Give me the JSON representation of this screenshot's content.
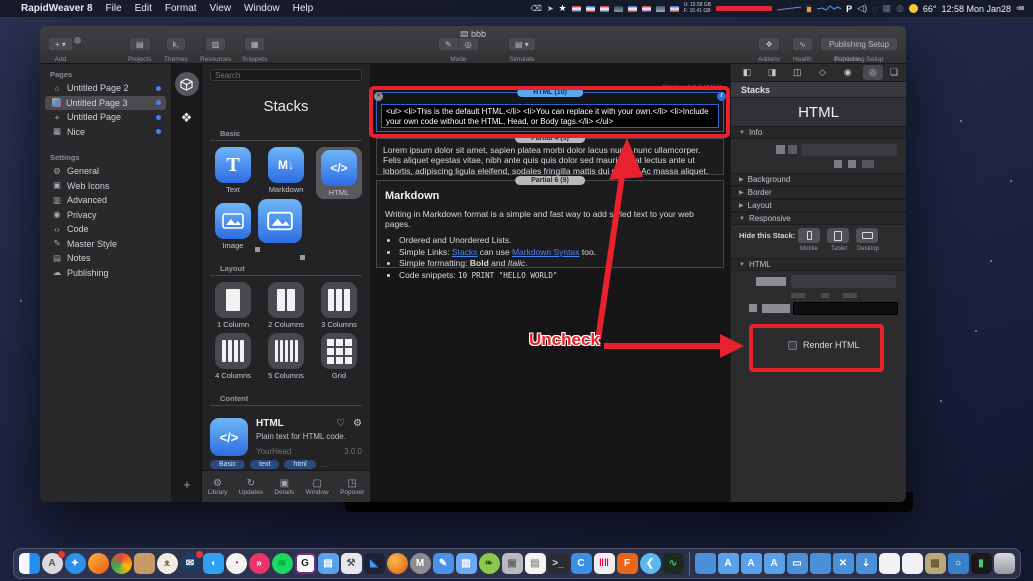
{
  "menu_bar": {
    "apple": "",
    "items": [
      "RapidWeaver 8",
      "File",
      "Edit",
      "Format",
      "View",
      "Window",
      "Help"
    ],
    "status": {
      "mem_used": "U: 15.58 GB",
      "mem_free": "F: 16.41 GB",
      "p_icon": "P",
      "temp": "66°",
      "clock": "12:58 Mon Jan28"
    }
  },
  "window": {
    "title": "bbb",
    "toolbar": {
      "add": "Add",
      "projects": "Projects",
      "themes": "Themes",
      "resources": "Resources",
      "snippets": "Snippets",
      "mode": "Mode",
      "simulate": "Simulate",
      "addons": "Addons",
      "health": "Health",
      "inspector": "Inspector",
      "publishing_button": "Publishing Setup",
      "publishing_caption": "Publishing Setup"
    }
  },
  "sidebar": {
    "pages_label": "Pages",
    "pages": [
      {
        "label": "Untitled Page 2"
      },
      {
        "label": "Untitled Page 3"
      },
      {
        "label": "Untitled Page"
      },
      {
        "label": "Nice"
      }
    ],
    "settings_label": "Settings",
    "settings": [
      {
        "label": "General"
      },
      {
        "label": "Web Icons"
      },
      {
        "label": "Advanced"
      },
      {
        "label": "Privacy"
      },
      {
        "label": "Code"
      },
      {
        "label": "Master Style"
      },
      {
        "label": "Notes"
      },
      {
        "label": "Publishing"
      }
    ]
  },
  "library": {
    "search_placeholder": "Search",
    "title": "Stacks",
    "basic_label": "Basic",
    "basic": [
      {
        "label": "Text",
        "glyph": "T"
      },
      {
        "label": "Markdown",
        "glyph": "M↓"
      },
      {
        "label": "HTML",
        "glyph": "</>"
      },
      {
        "label": "Image",
        "glyph": ""
      }
    ],
    "layout_label": "Layout",
    "layout": [
      {
        "label": "1 Column"
      },
      {
        "label": "2 Columns"
      },
      {
        "label": "3 Columns"
      },
      {
        "label": "4 Columns"
      },
      {
        "label": "5 Columns"
      },
      {
        "label": "Grid"
      }
    ],
    "content_label": "Content",
    "detail": {
      "name": "HTML",
      "glyph": "</>",
      "desc": "Plain text for HTML code.",
      "vendor": "YourHead",
      "version": "3.0.0",
      "tags": [
        "Basic",
        "text",
        "html"
      ],
      "more_tags": "..."
    },
    "footer": [
      {
        "label": "Library"
      },
      {
        "label": "Updates"
      },
      {
        "label": "Details"
      },
      {
        "label": "Window"
      },
      {
        "label": "Popover"
      }
    ]
  },
  "canvas": {
    "version": "Stacks v4.0.0 (4413)",
    "html_pill": "HTML (10)",
    "html_code": "<ul> <li>This is the default HTML.</li> <li>You can replace it with your own.</li> <li>Include your own code without the HTML, Head, or Body tags.</li> </ul>",
    "partial1_pill": "Partial 4 (9)",
    "lorem": "Lorem ipsum dolor sit amet, sapien platea morbi dolor lacus nunc, nunc ullamcorper. Felis aliquet egestas vitae, nibh ante quis quis dolor sed mauris. Erat lectus ante ut lobortis, adipiscing ligula eleifend, sodales fringilla mattis dui nullam. Ac massa aliquet.",
    "partial2_pill": "Partial 6 (9)",
    "markdown": {
      "title": "Markdown",
      "intro": "Writing in Markdown format is a simple and fast way to add styled text to your web pages.",
      "b1": "Ordered and Unordered Lists.",
      "b2_pre": "Simple Links: ",
      "b2_link1": "Stacks",
      "b2_mid": " can use ",
      "b2_link2": "Markdown Syntax",
      "b2_post": " too.",
      "b3_pre": "Simple formatting: ",
      "b3_bold": "Bold",
      "b3_mid": " and ",
      "b3_italic": "Italic",
      "b3_post": ".",
      "b4_pre": "Code snippets: ",
      "b4_code": "10 PRINT \"HELLO WORLD\""
    }
  },
  "inspector": {
    "header": "Stacks",
    "title": "HTML",
    "sections": {
      "info": "Info",
      "background": "Background",
      "border": "Border",
      "layout": "Layout",
      "responsive": "Responsive",
      "html": "HTML"
    },
    "hide_label": "Hide this Stack:",
    "devices": [
      {
        "label": "Mobile"
      },
      {
        "label": "Tablet"
      },
      {
        "label": "Desktop"
      }
    ],
    "render_label": "Render HTML"
  },
  "annotations": {
    "uncheck": "Uncheck",
    "color": "#e8222c"
  },
  "dock": {
    "items": [
      {
        "n": "finder",
        "c": "linear-gradient(90deg,#f5f7fa 50%,#1f8ef0 50%)",
        "s": "sq",
        "g": ""
      },
      {
        "n": "app-store",
        "c": "#d9d9de",
        "s": "ci",
        "g": "A",
        "fg": "#555",
        "badge": true
      },
      {
        "n": "safari",
        "c": "#2f90ea",
        "s": "ci",
        "g": "✦"
      },
      {
        "n": "firefox",
        "c": "linear-gradient(135deg,#ffb340,#e85d10)",
        "s": "ci",
        "g": ""
      },
      {
        "n": "chrome",
        "c": "conic-gradient(#ea4335,#fbbc05,#34a853,#ea4335)",
        "s": "ci",
        "g": "◦",
        "fg": "#4a90e2"
      },
      {
        "n": "rss-reader",
        "c": "#c79a66",
        "s": "sq",
        "g": ""
      },
      {
        "n": "dog-app",
        "c": "#f2ebe2",
        "s": "ci",
        "g": "ᴥ",
        "fg": "#8a6a4a"
      },
      {
        "n": "mail-clock",
        "c": "#1c3c62",
        "s": "ci",
        "g": "✉",
        "badge": true
      },
      {
        "n": "messages",
        "c": "#2fa0f2",
        "s": "sq",
        "g": "◖"
      },
      {
        "n": "color-wheel",
        "c": "#f2f2f4",
        "s": "ci",
        "g": "◔",
        "fg": "#e06"
      },
      {
        "n": "shift",
        "c": "#e8356c",
        "s": "ci",
        "g": "»"
      },
      {
        "n": "spotify",
        "c": "#1ed760",
        "s": "ci",
        "g": "≋",
        "fg": "#0a3"
      },
      {
        "n": "genius",
        "c": "#ffffff",
        "s": "sq",
        "g": "G",
        "fg": "#222",
        "bd": "#7a2a8a"
      },
      {
        "n": "textastic",
        "c": "#5aa2ec",
        "s": "sq",
        "g": "▤"
      },
      {
        "n": "build-tool",
        "c": "#e8e8ec",
        "s": "sq",
        "g": "⚒",
        "fg": "#555"
      },
      {
        "n": "vscode",
        "c": "#1e2232",
        "s": "sq",
        "g": "◣",
        "fg": "#3b9af0"
      },
      {
        "n": "orange-ball",
        "c": "radial-gradient(circle at 35% 35%,#ffb650,#d85f10)",
        "s": "ci",
        "g": ""
      },
      {
        "n": "m-app",
        "c": "#8c8c92",
        "s": "ci",
        "g": "M"
      },
      {
        "n": "blue-editor-1",
        "c": "#4a92ea",
        "s": "sq",
        "g": "✎"
      },
      {
        "n": "blue-editor-2",
        "c": "#6cabf2",
        "s": "sq",
        "g": "▥"
      },
      {
        "n": "coteditor",
        "c": "#8ac94c",
        "s": "ci",
        "g": "❧",
        "fg": "#2a5a10"
      },
      {
        "n": "photos-gray",
        "c": "#b9b9be",
        "s": "sq",
        "g": "▣",
        "fg": "#666"
      },
      {
        "n": "notes",
        "c": "#f4f4ee",
        "s": "sq",
        "g": "▤",
        "fg": "#999"
      },
      {
        "n": "terminal",
        "c": "#2b2b30",
        "s": "sq",
        "g": ">_",
        "fg": "#ddd"
      },
      {
        "n": "coda",
        "c": "#3a90e2",
        "s": "sq",
        "g": "C"
      },
      {
        "n": "color-bars",
        "c": "#f0f0f2",
        "s": "sq",
        "g": "‖‖",
        "fg": "#e04"
      },
      {
        "n": "fontlab",
        "c": "#e8651a",
        "s": "sq",
        "g": "F"
      },
      {
        "n": "twitter",
        "c": "#5ab9f2",
        "s": "ci",
        "g": "❮",
        "fg": "#ffd"
      },
      {
        "n": "activity",
        "c": "#1c2a20",
        "s": "sq",
        "g": "∿",
        "fg": "#3ec46a"
      },
      {
        "n": "sep",
        "sep": true
      },
      {
        "n": "folder-1",
        "c": "#4a90d8",
        "s": "fo",
        "g": ""
      },
      {
        "n": "folder-apps-1",
        "c": "#5aa0e8",
        "s": "fo",
        "g": "A"
      },
      {
        "n": "folder-apps-2",
        "c": "#5aa0e8",
        "s": "fo",
        "g": "A"
      },
      {
        "n": "folder-apps-3",
        "c": "#5aa0e8",
        "s": "fo",
        "g": "A"
      },
      {
        "n": "folder-2",
        "c": "#4a90d8",
        "s": "fo",
        "g": "▭"
      },
      {
        "n": "folder-3",
        "c": "#4a90d8",
        "s": "fo",
        "g": ""
      },
      {
        "n": "folder-x",
        "c": "#4a90d8",
        "s": "fo",
        "g": "✕"
      },
      {
        "n": "folder-downloads",
        "c": "#4a90d8",
        "s": "fo",
        "g": "⇣"
      },
      {
        "n": "document-1",
        "c": "#f2f2f4",
        "s": "sq",
        "g": "",
        "fg": "#888"
      },
      {
        "n": "document-2",
        "c": "#f2f2f4",
        "s": "sq",
        "g": "",
        "fg": "#888"
      },
      {
        "n": "pixel-image",
        "c": "#b9a878",
        "s": "sq",
        "g": "▩",
        "fg": "#6a5a30"
      },
      {
        "n": "folder-o",
        "c": "#3a80c8",
        "s": "fo",
        "g": "○"
      },
      {
        "n": "terminal-window",
        "c": "#19191c",
        "s": "sq",
        "g": "▮",
        "fg": "#4ec46a"
      },
      {
        "n": "trash",
        "c": "linear-gradient(#d8d8de,#9a9aa2)",
        "s": "sq",
        "g": ""
      }
    ]
  }
}
